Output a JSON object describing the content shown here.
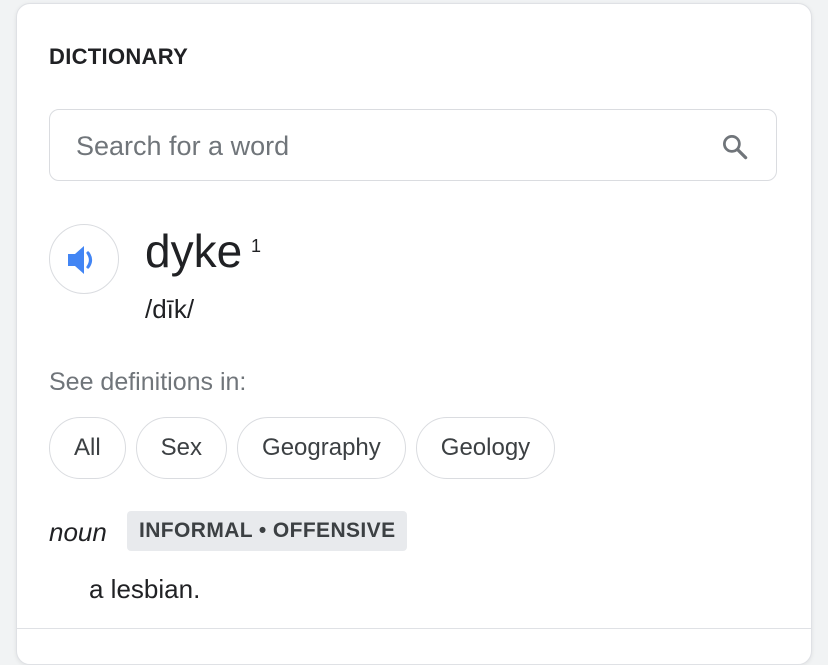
{
  "dictionary": {
    "title": "DICTIONARY",
    "search": {
      "placeholder": "Search for a word",
      "value": "",
      "icon": "search-icon"
    },
    "entry": {
      "speaker_icon": "volume-icon",
      "word": "dyke",
      "homograph_number": "1",
      "pronunciation": "/dīk/"
    },
    "see_definitions_label": "See definitions in:",
    "categories": [
      {
        "label": "All"
      },
      {
        "label": "Sex"
      },
      {
        "label": "Geography"
      },
      {
        "label": "Geology"
      }
    ],
    "sense": {
      "part_of_speech": "noun",
      "usage_label": "INFORMAL • OFFENSIVE",
      "definition": "a lesbian."
    },
    "colors": {
      "accent_blue": "#4285f4",
      "muted_text": "#70757a",
      "badge_bg": "#e8eaed"
    }
  }
}
